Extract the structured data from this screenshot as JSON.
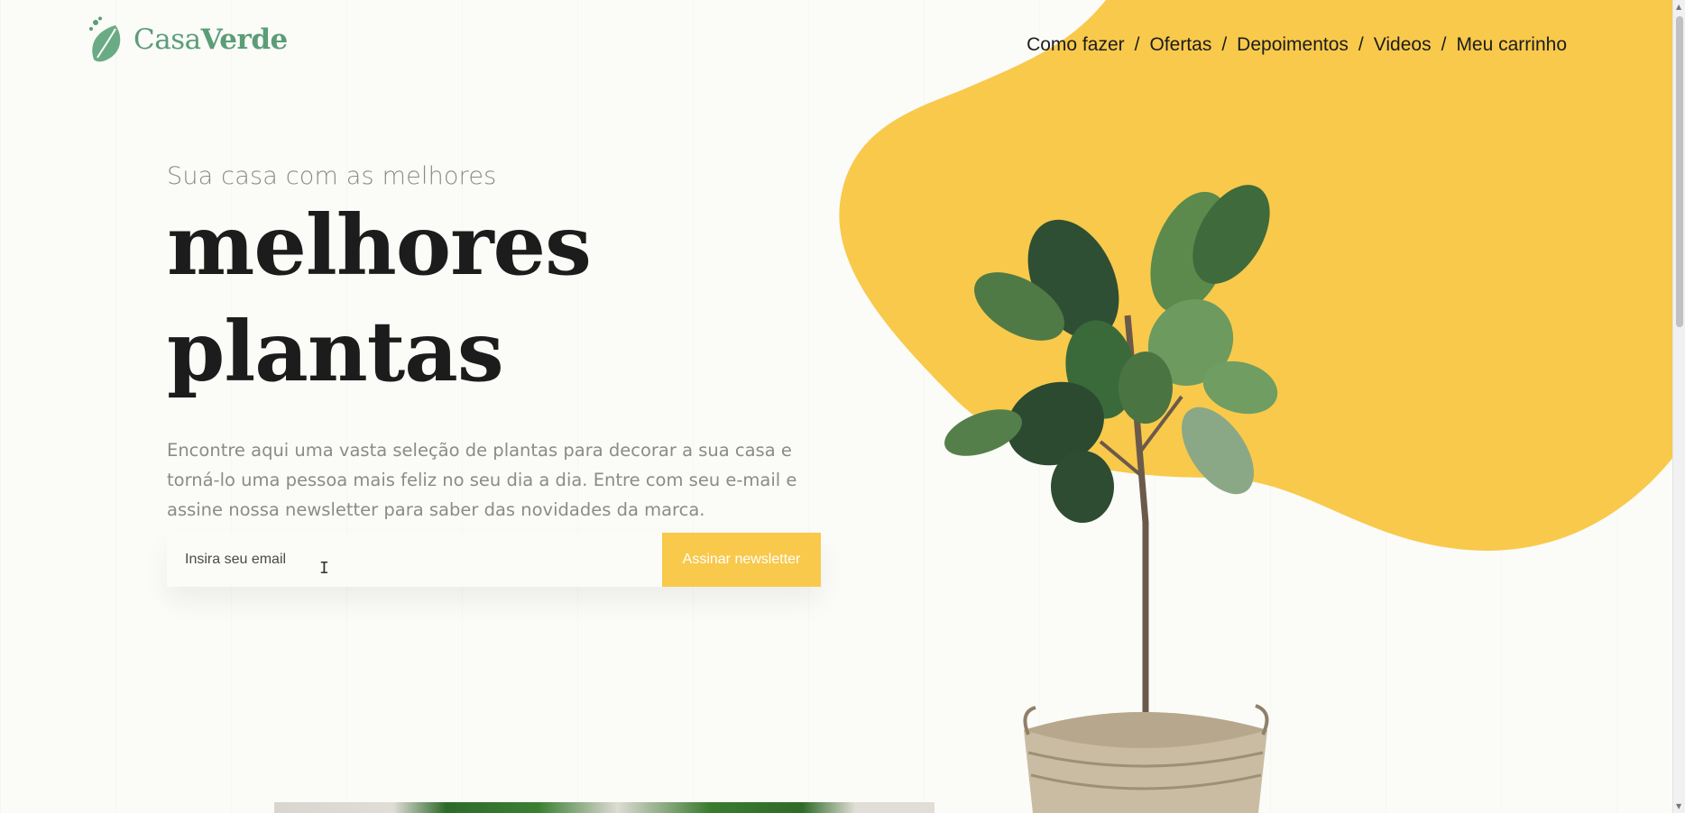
{
  "brand": {
    "name_light": "Casa",
    "name_bold": "Verde",
    "accent_green": "#5c9d78",
    "accent_yellow": "#f8c94b"
  },
  "nav": {
    "items": [
      {
        "label": "Como fazer"
      },
      {
        "label": "Ofertas"
      },
      {
        "label": "Depoimentos"
      },
      {
        "label": "Videos"
      },
      {
        "label": "Meu carrinho"
      }
    ],
    "separator": "/"
  },
  "hero": {
    "subtitle": "Sua casa com as melhores",
    "headline_line1": "melhores",
    "headline_line2": "plantas",
    "description": "Encontre aqui uma vasta seleção de plantas para decorar a sua casa e torná-lo uma pessoa mais feliz no seu dia a dia. Entre com seu e-mail e assine nossa newsletter para saber das novidades da marca."
  },
  "newsletter": {
    "email_placeholder": "Insira seu email",
    "email_value": "",
    "submit_label": "Assinar newsletter"
  },
  "icons": {
    "logo": "leaf-logo-icon",
    "cursor": "text-cursor-icon",
    "scroll_up": "scroll-up-arrow-icon",
    "scroll_down": "scroll-down-arrow-icon"
  }
}
